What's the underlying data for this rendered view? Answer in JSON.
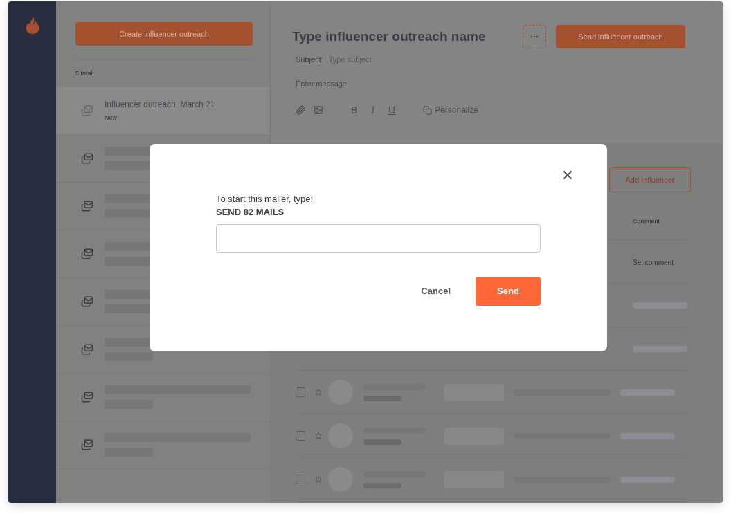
{
  "list": {
    "create_button": "Create influencer outreach",
    "total": "5 total",
    "items": [
      {
        "title": "Influencer outreach, March 21",
        "status": "New",
        "selected": true
      },
      {
        "selected": false
      },
      {
        "selected": false
      },
      {
        "selected": false
      },
      {
        "selected": false
      },
      {
        "selected": false
      },
      {
        "selected": false
      },
      {
        "selected": false
      }
    ]
  },
  "editor": {
    "title": "Type influencer outreach name",
    "send_button": "Send influencer outreach",
    "subject_label": "Subject:",
    "subject_placeholder": "Type subject",
    "message_placeholder": "Enter message",
    "toolbar": [
      {
        "kind": "attach"
      },
      {
        "kind": "image"
      },
      {
        "kind": "bold",
        "label": "B"
      },
      {
        "kind": "italic",
        "label": "I"
      },
      {
        "kind": "underline",
        "label": "U"
      },
      {
        "kind": "personalize",
        "label": "Personalize"
      }
    ]
  },
  "table": {
    "add_button": "Add Influencer",
    "columns": [
      {
        "label": "Comment"
      }
    ],
    "rows": [
      {
        "kind": "covered",
        "comment": "Set comment"
      },
      {
        "kind": "covered"
      },
      {
        "kind": "covered"
      },
      {
        "kind": "full",
        "checked": false
      },
      {
        "kind": "full",
        "checked": false
      },
      {
        "kind": "full",
        "checked": false
      }
    ]
  },
  "dialog": {
    "prompt": "To start this mailer, type:",
    "code": "SEND 82 MAILS",
    "buttons": [
      {
        "label": "Cancel",
        "kind": "secondary"
      },
      {
        "label": "Send",
        "kind": "primary"
      }
    ]
  }
}
